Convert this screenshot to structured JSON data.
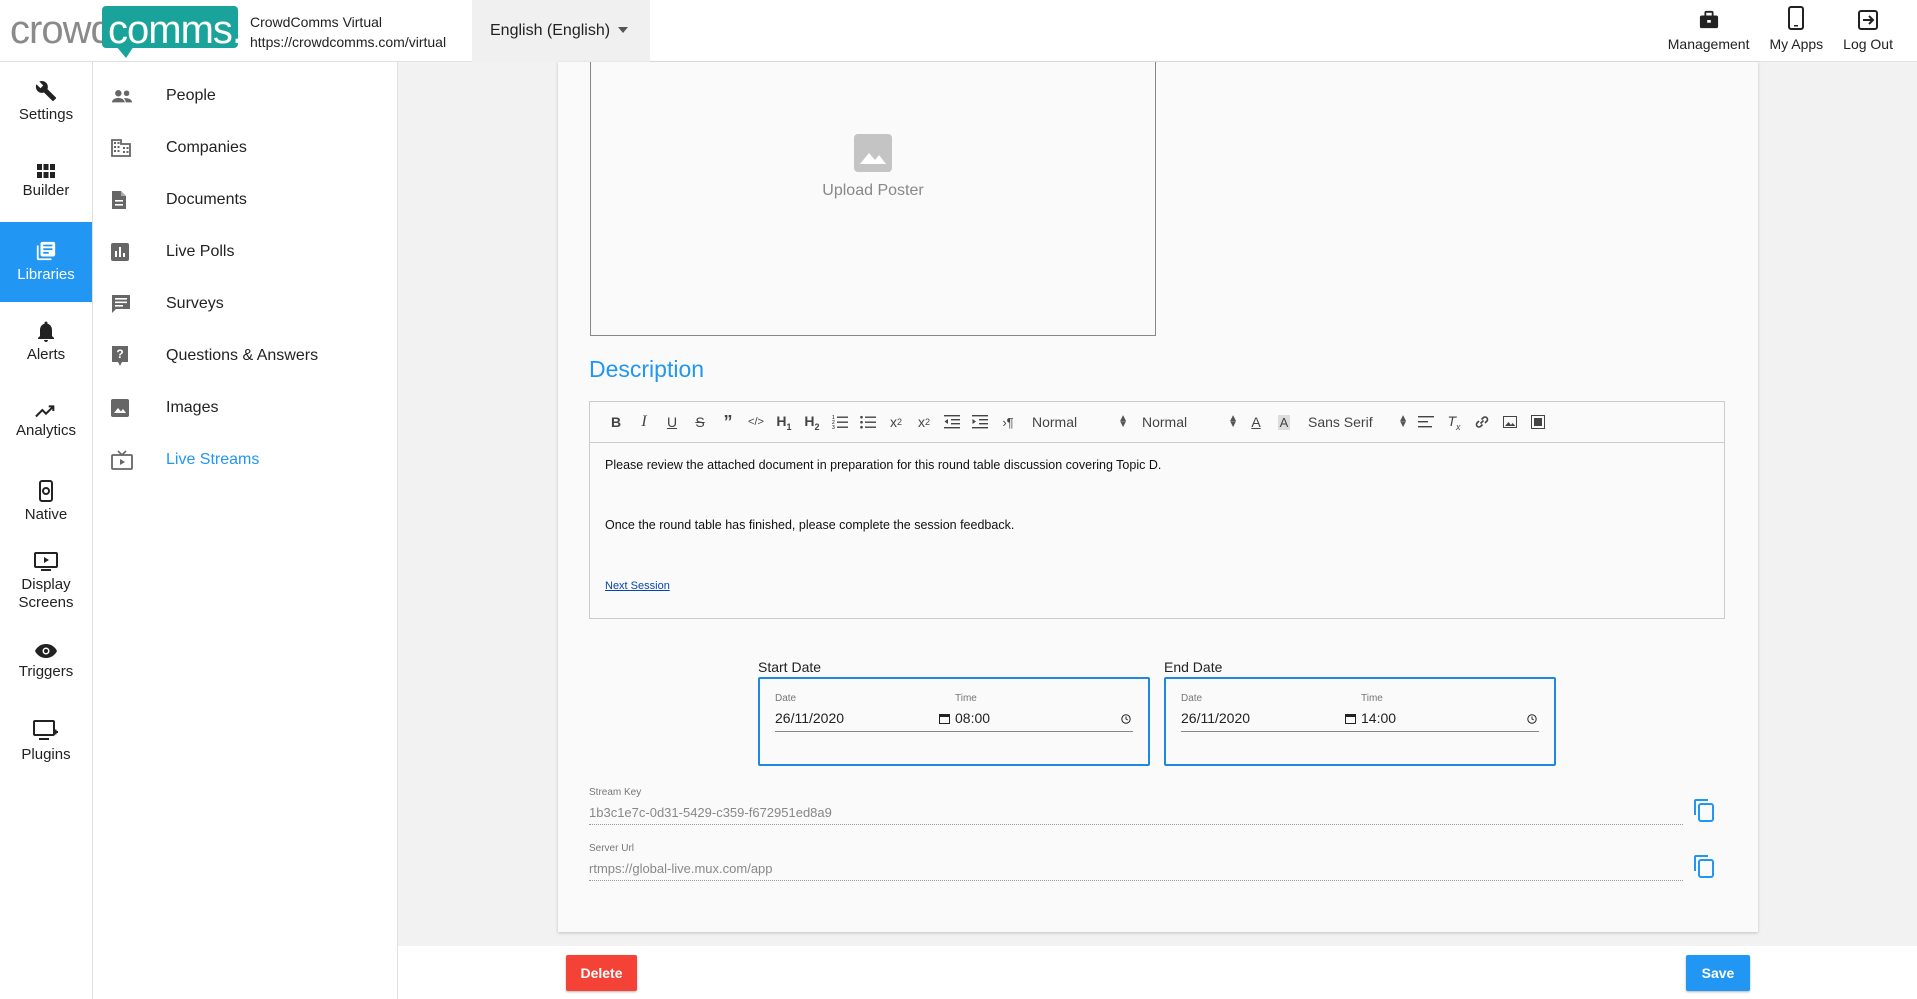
{
  "app": {
    "logo_part1": "crowd",
    "logo_part2": "comms.",
    "name": "CrowdComms Virtual",
    "url": "https://crowdcomms.com/virtual",
    "language": "English (English)"
  },
  "topnav": [
    {
      "label": "Management",
      "icon": "briefcase-icon"
    },
    {
      "label": "My Apps",
      "icon": "phone-icon"
    },
    {
      "label": "Log Out",
      "icon": "logout-icon"
    }
  ],
  "rail": [
    {
      "label": "Settings",
      "icon": "wrench-icon"
    },
    {
      "label": "Builder",
      "icon": "grid-icon"
    },
    {
      "label": "Libraries",
      "icon": "library-icon",
      "active": true
    },
    {
      "label": "Alerts",
      "icon": "bell-icon"
    },
    {
      "label": "Analytics",
      "icon": "trending-icon"
    },
    {
      "label": "Native",
      "icon": "mobile-settings-icon"
    },
    {
      "label": "Display Screens",
      "icon": "display-icon"
    },
    {
      "label": "Triggers",
      "icon": "eye-icon"
    },
    {
      "label": "Plugins",
      "icon": "plugin-icon"
    }
  ],
  "subnav": [
    {
      "label": "People",
      "icon": "people-icon"
    },
    {
      "label": "Companies",
      "icon": "building-icon"
    },
    {
      "label": "Documents",
      "icon": "document-icon"
    },
    {
      "label": "Live Polls",
      "icon": "poll-icon"
    },
    {
      "label": "Surveys",
      "icon": "survey-icon"
    },
    {
      "label": "Questions & Answers",
      "icon": "question-icon"
    },
    {
      "label": "Images",
      "icon": "image-icon"
    },
    {
      "label": "Live Streams",
      "icon": "live-tv-icon",
      "active": true
    }
  ],
  "poster": {
    "upload_label": "Upload Poster"
  },
  "description": {
    "title": "Description",
    "toolbar": {
      "size_select": "Normal",
      "header_select": "Normal",
      "font_select": "Sans Serif"
    },
    "paragraphs": [
      "Please review the attached document in preparation for this round table discussion covering Topic D.",
      "Once the round table has finished, please complete the session feedback."
    ],
    "link": "Next Session"
  },
  "start": {
    "label": "Start Date",
    "date_label": "Date",
    "date": "26/11/2020",
    "time_label": "Time",
    "time": "08:00"
  },
  "end": {
    "label": "End Date",
    "date_label": "Date",
    "date": "26/11/2020",
    "time_label": "Time",
    "time": "14:00"
  },
  "stream_key": {
    "label": "Stream Key",
    "value": "1b3c1e7c-0d31-5429-c359-f672951ed8a9"
  },
  "server_url": {
    "label": "Server Url",
    "value": "rtmps://global-live.mux.com/app"
  },
  "actions": {
    "delete": "Delete",
    "save": "Save",
    "delete_color": "#f44336",
    "save_color": "#2196f3"
  }
}
